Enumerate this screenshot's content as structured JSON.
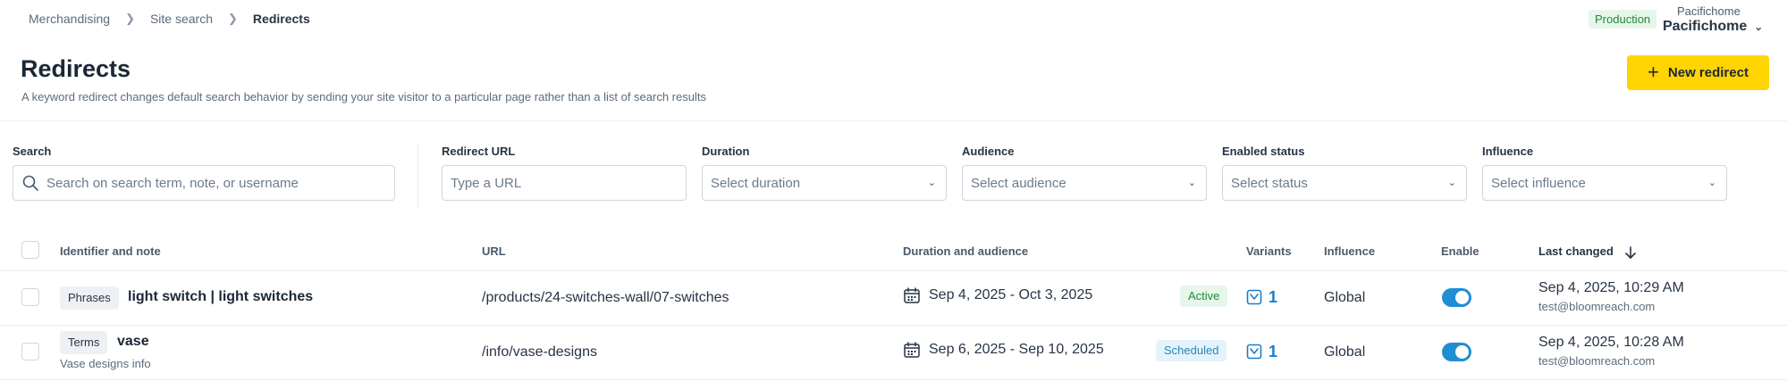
{
  "breadcrumb": [
    "Merchandising",
    "Site search",
    "Redirects"
  ],
  "environment": "Production",
  "account": {
    "org": "Pacifichome",
    "name": "Pacifichome"
  },
  "page": {
    "title": "Redirects",
    "subtitle": "A keyword redirect changes default search behavior by sending your site visitor to a particular page rather than a list of search results",
    "new_button": "New redirect"
  },
  "filters": {
    "search": {
      "label": "Search",
      "placeholder": "Search on search term, note, or username"
    },
    "redirect_url": {
      "label": "Redirect URL",
      "placeholder": "Type a URL"
    },
    "duration": {
      "label": "Duration",
      "placeholder": "Select duration"
    },
    "audience": {
      "label": "Audience",
      "placeholder": "Select audience"
    },
    "enabled_status": {
      "label": "Enabled status",
      "placeholder": "Select status"
    },
    "influence": {
      "label": "Influence",
      "placeholder": "Select influence"
    }
  },
  "table": {
    "headers": {
      "identifier": "Identifier and note",
      "url": "URL",
      "duration": "Duration and audience",
      "variants": "Variants",
      "influence": "Influence",
      "enable": "Enable",
      "last_changed": "Last changed"
    },
    "sort_icon": "arrow-down-icon",
    "rows": [
      {
        "type": "Phrases",
        "identifier": "light switch | light switches",
        "note": "",
        "url": "/products/24-switches-wall/07-switches",
        "duration": "Sep 4, 2025 - Oct 3, 2025",
        "status": "Active",
        "variants": "1",
        "influence": "Global",
        "enabled": true,
        "last_changed": "Sep 4, 2025, 10:29 AM",
        "user": "test@bloomreach.com"
      },
      {
        "type": "Terms",
        "identifier": "vase",
        "note": "Vase designs info",
        "url": "/info/vase-designs",
        "duration": "Sep 6, 2025 - Sep 10, 2025",
        "status": "Scheduled",
        "variants": "1",
        "influence": "Global",
        "enabled": true,
        "last_changed": "Sep 4, 2025, 10:28 AM",
        "user": "test@bloomreach.com"
      }
    ]
  },
  "colors": {
    "primary_button": "#ffd400",
    "toggle_on": "#1f8fd4",
    "active": "#1f8a3a",
    "scheduled": "#2a86b8"
  }
}
